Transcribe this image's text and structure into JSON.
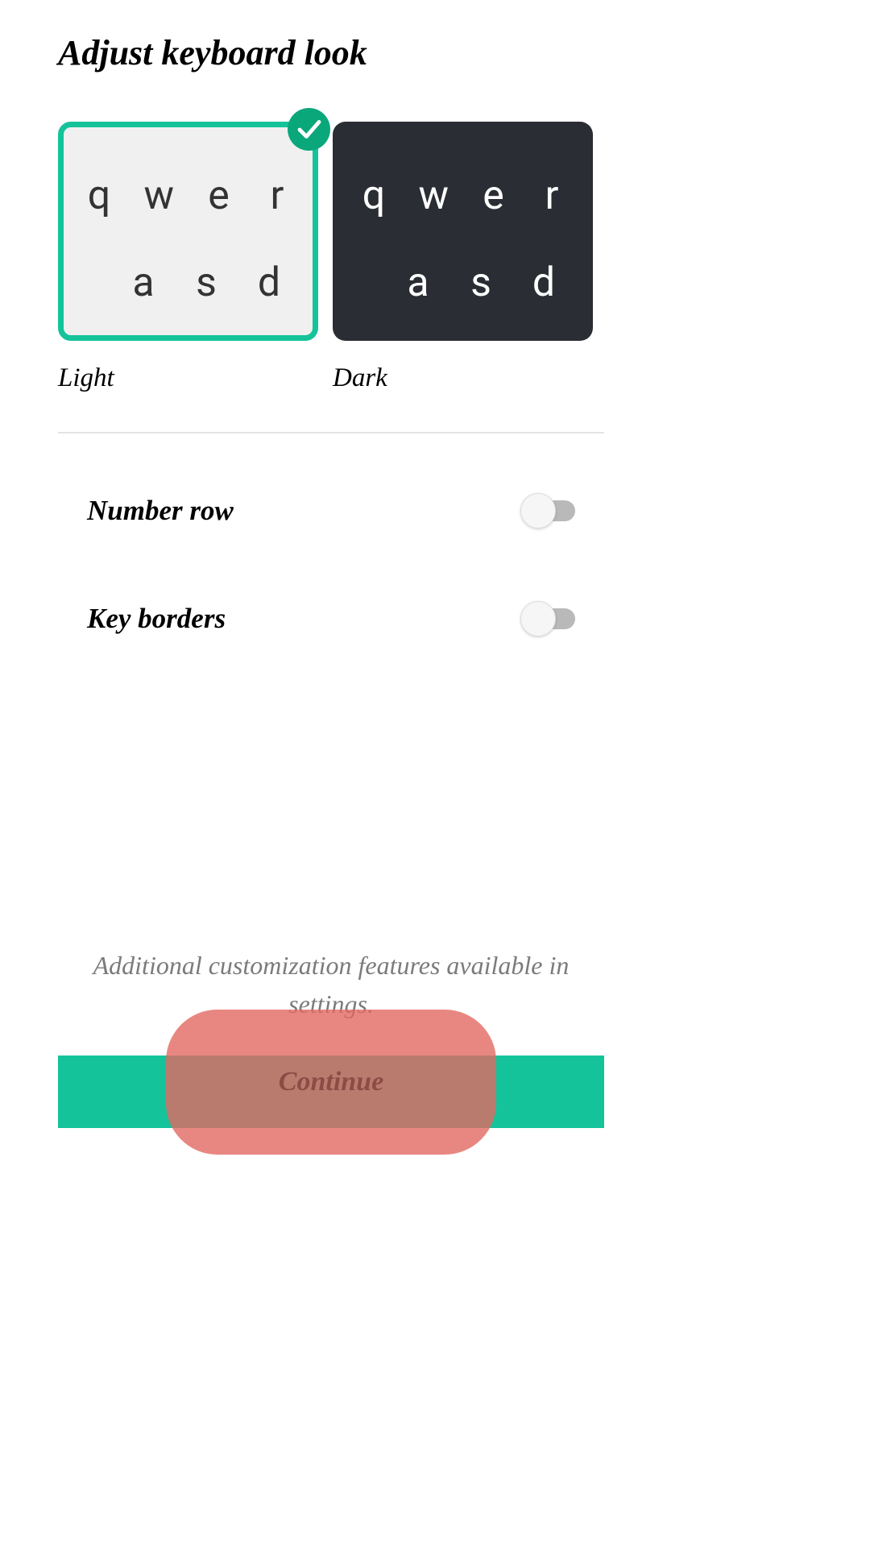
{
  "title": "Adjust keyboard look",
  "themes": [
    {
      "id": "light",
      "label": "Light",
      "selected": true
    },
    {
      "id": "dark",
      "label": "Dark",
      "selected": false
    }
  ],
  "sample_keys_row1": [
    "q",
    "w",
    "e",
    "r"
  ],
  "sample_keys_row2": [
    "a",
    "s",
    "d"
  ],
  "settings": {
    "number_row": {
      "label": "Number row",
      "checked": false
    },
    "key_borders": {
      "label": "Key borders",
      "checked": false
    }
  },
  "footer_note": "Additional customization features available in settings.",
  "continue_label": "Continue",
  "colors": {
    "accent": "#15c39a",
    "check_badge": "#0aa77b",
    "dark_tile": "#2a2d33",
    "light_tile": "#f0f0f0",
    "touch_overlay": "#e26962"
  }
}
